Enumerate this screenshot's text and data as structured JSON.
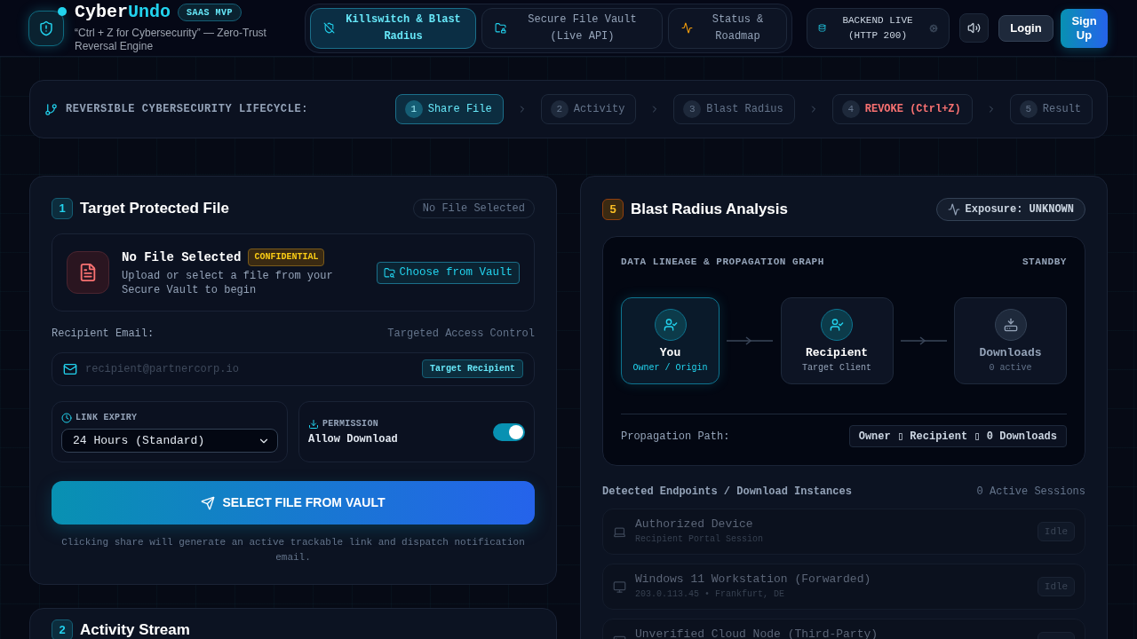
{
  "header": {
    "brand": {
      "name_main": "Cyber",
      "name_accent": "Undo",
      "badge": "SAAS MVP",
      "tagline": "“Ctrl + Z for Cybersecurity” — Zero-Trust Reversal Engine"
    },
    "nav_tabs": [
      {
        "label": "Killswitch & Blast Radius",
        "selected": true
      },
      {
        "label": "Secure File Vault (Live API)",
        "selected": false
      },
      {
        "label": "Status & Roadmap",
        "selected": false
      }
    ],
    "backend_status": {
      "text": "BACKEND LIVE (HTTP 200)",
      "online": true
    },
    "login": "Login",
    "signup": "Sign Up"
  },
  "lifecycle": {
    "title": "REVERSIBLE CYBERSECURITY LIFECYCLE:",
    "steps": [
      {
        "number": "1",
        "label": "Share File",
        "kind": "step",
        "selected": true
      },
      {
        "number": "2",
        "label": "Activity",
        "kind": "step",
        "selected": false
      },
      {
        "number": "3",
        "label": "Blast Radius",
        "kind": "step",
        "selected": false
      },
      {
        "number": "4",
        "label": "REVOKE (Ctrl+Z)",
        "kind": "revoke",
        "selected": false
      },
      {
        "number": "5",
        "label": "Result",
        "kind": "step",
        "selected": false
      }
    ]
  },
  "share_panel": {
    "number": "1",
    "title": "Target Protected File",
    "status": "No File Selected",
    "file": {
      "name": "No File Selected",
      "badge": "CONFIDENTIAL",
      "description": "Upload or select a file from your Secure Vault to begin",
      "button": "Choose from Vault"
    },
    "recipient": {
      "label": "Recipient Email:",
      "hint": "Targeted Access Control",
      "placeholder": "recipient@partnercorp.io",
      "badge": "Target Recipient"
    },
    "expiry": {
      "label": "LINK EXPIRY",
      "value": "24 Hours (Standard)"
    },
    "permission": {
      "label": "PERMISSION",
      "value": "Allow Download",
      "on": true
    },
    "submit": "SELECT FILE FROM VAULT",
    "note": "Clicking share will generate an active trackable link and dispatch notification email."
  },
  "activity_panel": {
    "number": "2",
    "title": "Activity Stream"
  },
  "blast_panel": {
    "number": "5",
    "title": "Blast Radius Analysis",
    "exposure": "Exposure: UNKNOWN",
    "graph": {
      "title": "DATA LINEAGE & PROPAGATION GRAPH",
      "status": "STANDBY",
      "nodes": [
        {
          "name": "You",
          "role": "Owner / Origin",
          "selected": true,
          "active": true
        },
        {
          "name": "Recipient",
          "role": "Target Client",
          "selected": false,
          "active": true
        },
        {
          "name": "Downloads",
          "role": "0 active",
          "selected": false,
          "active": false
        }
      ],
      "path_label": "Propagation Path:",
      "path": "Owner ▯ Recipient ▯ 0 Downloads"
    },
    "endpoints": {
      "title": "Detected Endpoints / Download Instances",
      "count": "0 Active Sessions",
      "items": [
        {
          "name": "Authorized Device",
          "detail": "Recipient Portal Session",
          "status": "Idle",
          "active": false
        },
        {
          "name": "Windows 11 Workstation (Forwarded)",
          "detail": "203.0.113.45 • Frankfurt, DE",
          "status": "Idle",
          "active": false
        },
        {
          "name": "Unverified Cloud Node (Third-Party)",
          "active": false
        }
      ]
    }
  }
}
